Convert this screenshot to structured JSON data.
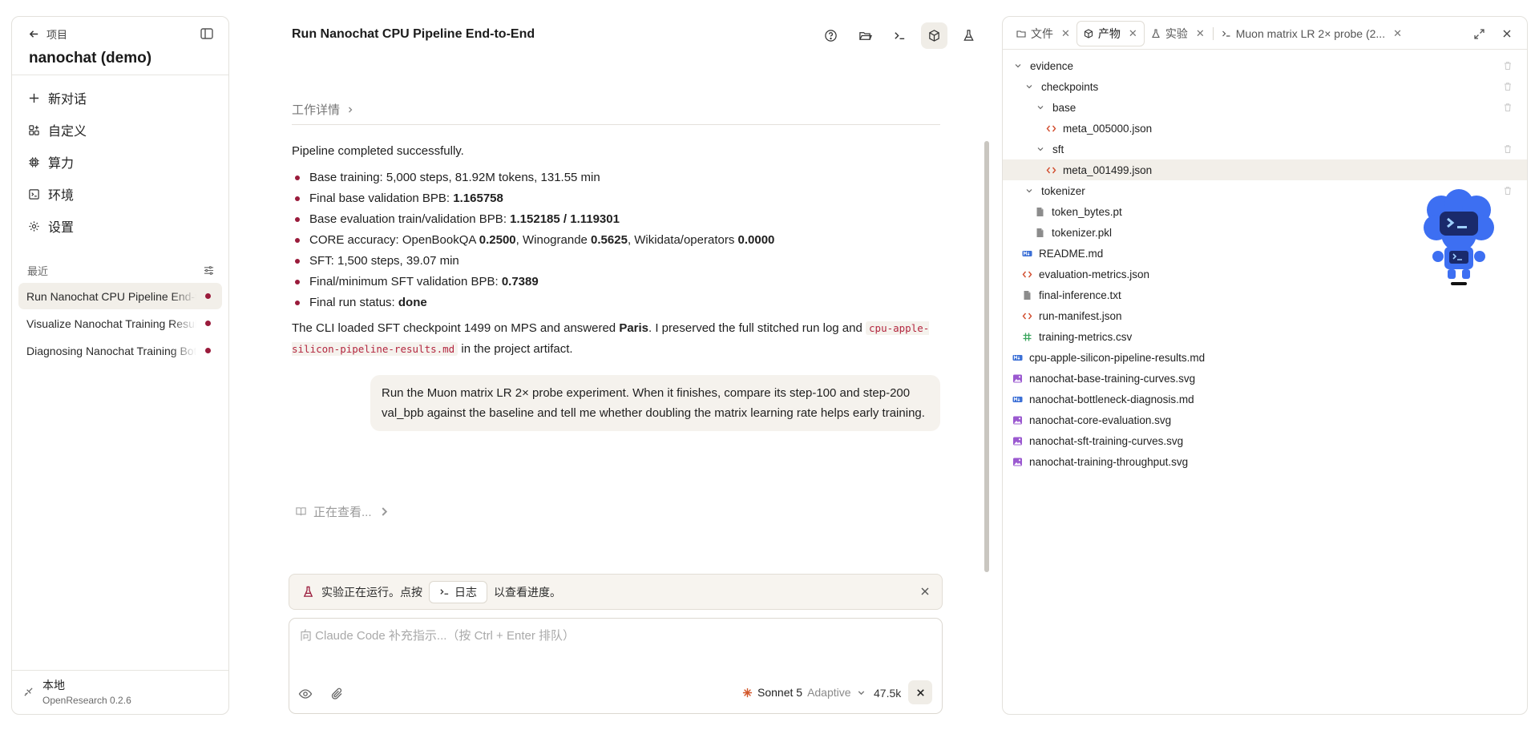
{
  "sidebar": {
    "back_label": "项目",
    "project_title": "nanochat (demo)",
    "nav": [
      {
        "label": "新对话",
        "icon": "plus-icon"
      },
      {
        "label": "自定义",
        "icon": "customize-icon"
      },
      {
        "label": "算力",
        "icon": "cpu-icon"
      },
      {
        "label": "环境",
        "icon": "environment-icon"
      },
      {
        "label": "设置",
        "icon": "gear-icon"
      }
    ],
    "recent_label": "最近",
    "recent": [
      {
        "label": "Run Nanochat CPU Pipeline End-to-End"
      },
      {
        "label": "Visualize Nanochat Training Results"
      },
      {
        "label": "Diagnosing Nanochat Training Bottlenecks"
      }
    ],
    "footer": {
      "name": "本地",
      "version": "OpenResearch 0.2.6"
    }
  },
  "center": {
    "title": "Run Nanochat CPU Pipeline End-to-End",
    "work_details": "工作详情",
    "message": {
      "intro": "Pipeline completed successfully.",
      "b1": "Base training: 5,000 steps, 81.92M tokens, 131.55 min",
      "b2_pre": "Final base validation BPB: ",
      "b2_val": "1.165758",
      "b3_pre": "Base evaluation train/validation BPB: ",
      "b3_val": "1.152185 / 1.119301",
      "b4_pre": "CORE accuracy: OpenBookQA ",
      "b4_v1": "0.2500",
      "b4_mid1": ", Winogrande ",
      "b4_v2": "0.5625",
      "b4_mid2": ", Wikidata/operators ",
      "b4_v3": "0.0000",
      "b5": "SFT: 1,500 steps, 39.07 min",
      "b6_pre": "Final/minimum SFT validation BPB: ",
      "b6_val": "0.7389",
      "b7_pre": "Final run status: ",
      "b7_val": "done",
      "p2_pre": "The CLI loaded SFT checkpoint 1499 on MPS and answered ",
      "p2_bold": "Paris",
      "p2_mid": ". I preserved the full stitched run log and ",
      "p2_code": "cpu-apple-silicon-pipeline-results.md",
      "p2_post": " in the project artifact."
    },
    "user_message": "Run the Muon matrix LR 2× probe experiment. When it finishes, compare its step-100 and step-200 val_bpb against the baseline and tell me whether doubling the matrix learning rate helps early training.",
    "viewing": "正在查看...",
    "notice": {
      "pre": "实验正在运行。点按",
      "button": "日志",
      "post": "以查看进度。"
    },
    "composer": {
      "placeholder": "向 Claude Code 补充指示...（按 Ctrl + Enter 排队）",
      "model": "Sonnet 5",
      "mode": "Adaptive",
      "tokens": "47.5k"
    }
  },
  "panel": {
    "tabs": [
      {
        "label": "文件",
        "icon": "folder-icon",
        "active": false
      },
      {
        "label": "产物",
        "icon": "package-icon",
        "active": true
      },
      {
        "label": "实验",
        "icon": "flask-icon",
        "active": false
      },
      {
        "label": "Muon matrix LR 2× probe (2...",
        "icon": "terminal-icon",
        "active": false
      }
    ],
    "tree": [
      {
        "label": "evidence",
        "type": "folder",
        "depth": 0
      },
      {
        "label": "checkpoints",
        "type": "folder",
        "depth": 1
      },
      {
        "label": "base",
        "type": "folder",
        "depth": 2
      },
      {
        "label": "meta_005000.json",
        "type": "json",
        "depth": 3
      },
      {
        "label": "sft",
        "type": "folder",
        "depth": 2
      },
      {
        "label": "meta_001499.json",
        "type": "json",
        "depth": 3,
        "selected": true
      },
      {
        "label": "tokenizer",
        "type": "folder",
        "depth": 1
      },
      {
        "label": "token_bytes.pt",
        "type": "file",
        "depth": 2
      },
      {
        "label": "tokenizer.pkl",
        "type": "file",
        "depth": 2
      },
      {
        "label": "README.md",
        "type": "md",
        "depth": 1
      },
      {
        "label": "evaluation-metrics.json",
        "type": "json",
        "depth": 1
      },
      {
        "label": "final-inference.txt",
        "type": "file",
        "depth": 1
      },
      {
        "label": "run-manifest.json",
        "type": "json",
        "depth": 1
      },
      {
        "label": "training-metrics.csv",
        "type": "csv",
        "depth": 1
      },
      {
        "label": "cpu-apple-silicon-pipeline-results.md",
        "type": "md",
        "depth": 0
      },
      {
        "label": "nanochat-base-training-curves.svg",
        "type": "img",
        "depth": 0
      },
      {
        "label": "nanochat-bottleneck-diagnosis.md",
        "type": "md",
        "depth": 0
      },
      {
        "label": "nanochat-core-evaluation.svg",
        "type": "img",
        "depth": 0
      },
      {
        "label": "nanochat-sft-training-curves.svg",
        "type": "img",
        "depth": 0
      },
      {
        "label": "nanochat-training-throughput.svg",
        "type": "img",
        "depth": 0
      }
    ]
  },
  "colors": {
    "accent": "#9a1b3b",
    "json_icon": "#d24d2e",
    "md_icon": "#3b6fd6",
    "img_icon": "#9b59d0",
    "csv_icon": "#3aa55d",
    "mascot": "#3d6ff2"
  }
}
